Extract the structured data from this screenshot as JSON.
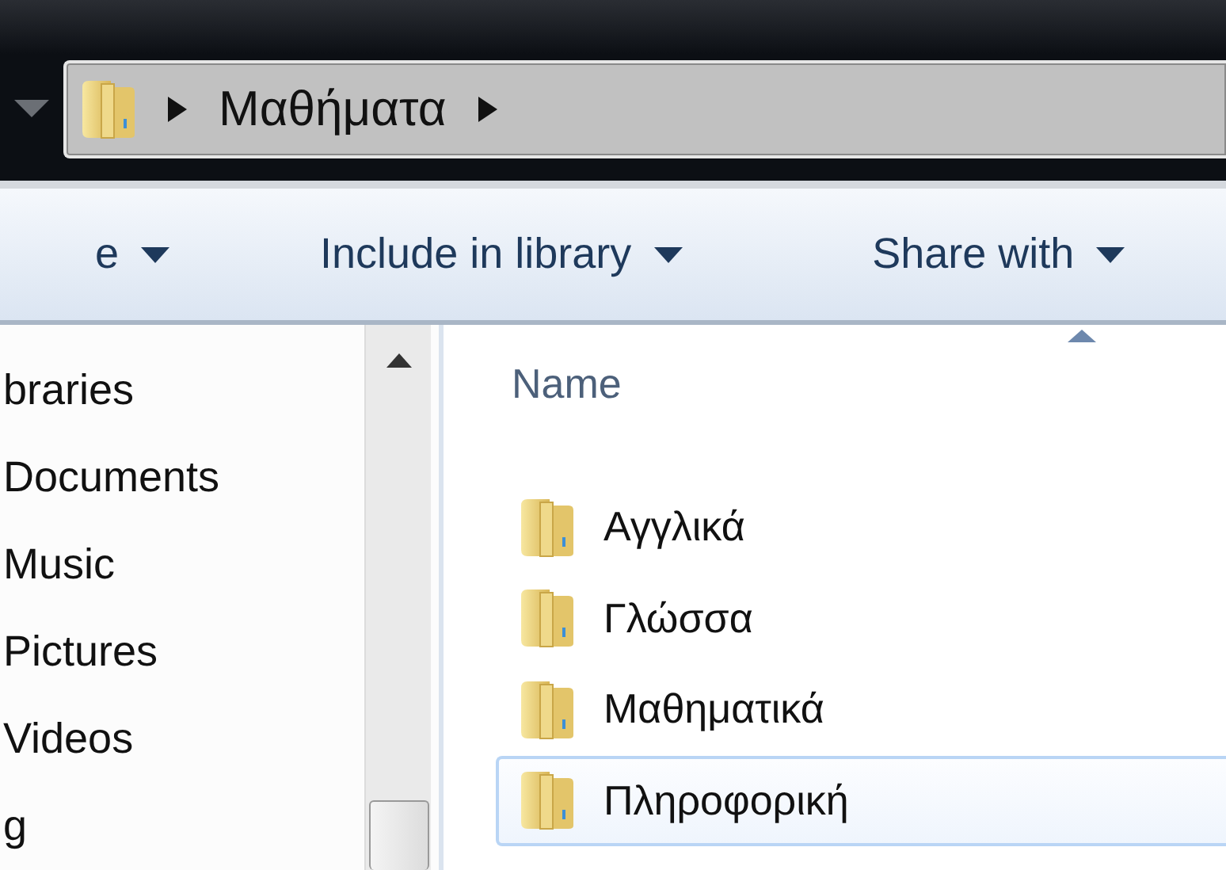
{
  "address_bar": {
    "crumbs": [
      "Μαθήματα"
    ]
  },
  "toolbar": {
    "buttons": [
      {
        "label": "e"
      },
      {
        "label": "Include in library"
      },
      {
        "label": "Share with"
      }
    ]
  },
  "navigation_pane": {
    "items": [
      {
        "label": "braries"
      },
      {
        "label": "Documents"
      },
      {
        "label": "Music"
      },
      {
        "label": "Pictures"
      },
      {
        "label": "Videos"
      },
      {
        "label": "g"
      }
    ]
  },
  "file_list": {
    "column": "Name",
    "items": [
      {
        "name": "Αγγλικά",
        "hovered": false
      },
      {
        "name": "Γλώσσα",
        "hovered": false
      },
      {
        "name": "Μαθηματικά",
        "hovered": false
      },
      {
        "name": "Πληροφορική",
        "hovered": true
      }
    ]
  }
}
